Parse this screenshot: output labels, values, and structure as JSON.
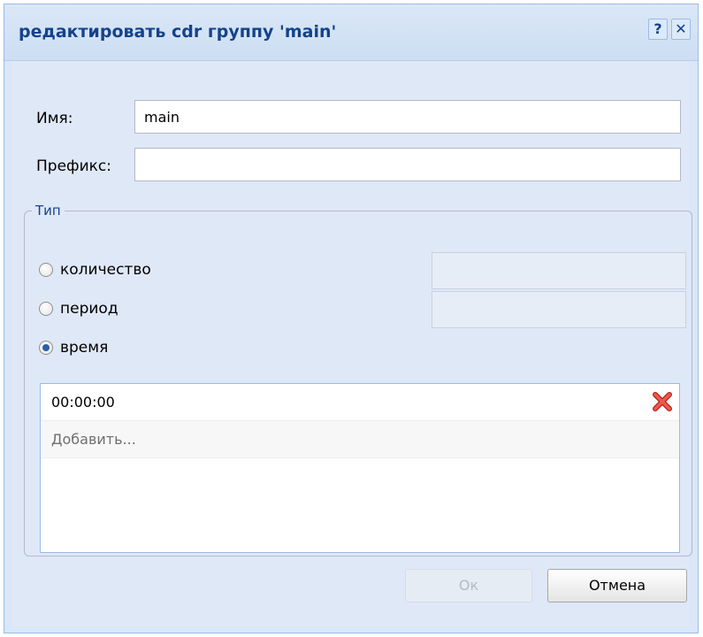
{
  "dialog": {
    "title": "редактировать cdr группу 'main'",
    "help_icon": "?",
    "close_icon": "✕"
  },
  "form": {
    "name_label": "Имя:",
    "name_value": "main",
    "prefix_label": "Префикс:",
    "prefix_value": ""
  },
  "type_group": {
    "legend": "Тип",
    "options": [
      {
        "label": "количество",
        "checked": false
      },
      {
        "label": "период",
        "checked": false
      },
      {
        "label": "время",
        "checked": true
      }
    ],
    "times": [
      "00:00:00"
    ],
    "add_label": "Добавить..."
  },
  "buttons": {
    "ok_label": "Ок",
    "cancel_label": "Отмена"
  },
  "colors": {
    "title": "#15428b",
    "dialog_bg": "#dfe8f6",
    "delete_icon": "#d9362e"
  },
  "icons": {
    "help": "help-icon",
    "close": "close-icon",
    "delete": "delete-icon"
  }
}
